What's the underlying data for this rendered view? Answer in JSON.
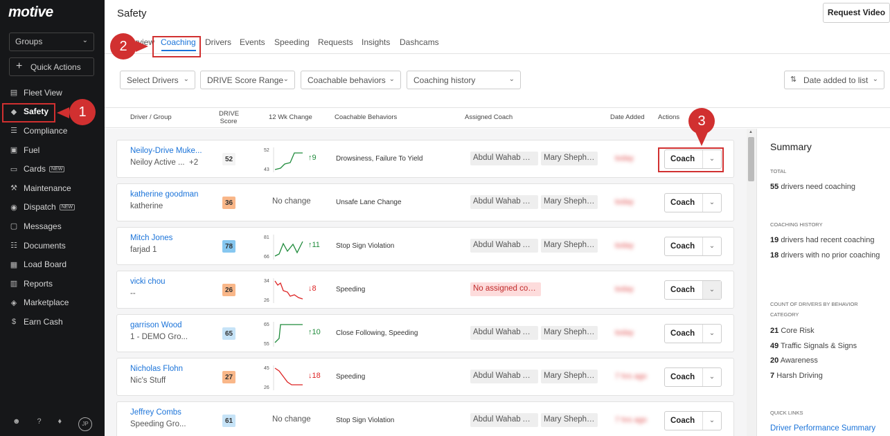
{
  "app": {
    "logo": "motive",
    "page_title": "Safety",
    "request_video": "Request Video"
  },
  "sidebar": {
    "groups_label": "Groups",
    "quick_actions": "Quick Actions",
    "items": [
      {
        "label": "Fleet View",
        "icon": "map-icon"
      },
      {
        "label": "Safety",
        "icon": "shield-icon",
        "active": true
      },
      {
        "label": "Compliance",
        "icon": "document-icon"
      },
      {
        "label": "Fuel",
        "icon": "fuel-icon"
      },
      {
        "label": "Cards",
        "icon": "card-icon",
        "badge": "NEW"
      },
      {
        "label": "Maintenance",
        "icon": "wrench-icon"
      },
      {
        "label": "Dispatch",
        "icon": "location-icon",
        "badge": "NEW"
      },
      {
        "label": "Messages",
        "icon": "messages-icon"
      },
      {
        "label": "Documents",
        "icon": "documents-icon"
      },
      {
        "label": "Load Board",
        "icon": "truck-icon"
      },
      {
        "label": "Reports",
        "icon": "reports-icon"
      },
      {
        "label": "Marketplace",
        "icon": "marketplace-icon"
      },
      {
        "label": "Earn Cash",
        "icon": "dollar-icon"
      }
    ],
    "footer_avatar": "JP"
  },
  "tabs": [
    "Overview",
    "Coaching",
    "Drivers",
    "Events",
    "Speeding",
    "Requests",
    "Insights",
    "Dashcams"
  ],
  "filters": [
    "Select Drivers",
    "DRIVE Score Range",
    "Coachable behaviors",
    "Coaching history"
  ],
  "sort_label": "Date added to list",
  "columns": [
    "Driver / Group",
    "DRIVE Score",
    "12 Wk Change",
    "Coachable Behaviors",
    "Assigned Coach",
    "Date Added",
    "Actions"
  ],
  "rows": [
    {
      "name": "Neiloy-Drive Muke...",
      "group": "Neiloy Active ...",
      "extra": "+2",
      "score": "52",
      "score_color": "#f4f4f4",
      "trend": "up",
      "spark_low": "43",
      "spark_high": "52",
      "change": "9",
      "behaviors": "Drowsiness, Failure To Yield",
      "coach1": "Abdul Wahab An...",
      "coach2": "Mary Shepherd",
      "date": "today",
      "action": "Coach"
    },
    {
      "name": "katherine goodman",
      "group": "katherine",
      "score": "36",
      "score_color": "#f9b789",
      "no_change": "No change",
      "behaviors": "Unsafe Lane Change",
      "coach1": "Abdul Wahab An...",
      "coach2": "Mary Shepherd",
      "date": "today",
      "action": "Coach"
    },
    {
      "name": "Mitch Jones",
      "group": "farjad 1",
      "score": "78",
      "score_color": "#86c7f0",
      "trend": "up",
      "spark_low": "66",
      "spark_high": "81",
      "change": "11",
      "behaviors": "Stop Sign Violation",
      "coach1": "Abdul Wahab An...",
      "coach2": "Mary Shepherd",
      "date": "today",
      "action": "Coach"
    },
    {
      "name": "vicki chou",
      "group": "--",
      "score": "26",
      "score_color": "#f9b789",
      "trend": "down",
      "spark_low": "26",
      "spark_high": "34",
      "change": "8",
      "behaviors": "Speeding",
      "coach1": "No assigned coach",
      "no_coach": true,
      "date": "today",
      "action": "Coach"
    },
    {
      "name": "garrison Wood",
      "group": "1 - DEMO Gro...",
      "score": "65",
      "score_color": "#c6e3f7",
      "trend": "up",
      "spark_low": "55",
      "spark_high": "65",
      "change": "10",
      "behaviors": "Close Following, Speeding",
      "coach1": "Abdul Wahab An...",
      "coach2": "Mary Shepherd",
      "date": "today",
      "action": "Coach"
    },
    {
      "name": "Nicholas Flohn",
      "group": "Nic's Stuff",
      "score": "27",
      "score_color": "#f9b789",
      "trend": "down",
      "spark_low": "26",
      "spark_high": "45",
      "change": "18",
      "behaviors": "Speeding",
      "coach1": "Abdul Wahab An...",
      "coach2": "Mary Shepherd",
      "date": "7 hrs ago",
      "action": "Coach"
    },
    {
      "name": "Jeffrey Combs",
      "group": "Speeding Gro...",
      "score": "61",
      "score_color": "#c6e3f7",
      "no_change": "No change",
      "behaviors": "Stop Sign Violation",
      "coach1": "Abdul Wahab An...",
      "coach2": "Mary Shepherd",
      "date": "7 hrs ago",
      "action": "Coach"
    }
  ],
  "summary": {
    "title": "Summary",
    "total_label": "TOTAL",
    "total_count": "55",
    "total_text": "drivers need coaching",
    "history_label": "COACHING HISTORY",
    "recent_count": "19",
    "recent_text": "drivers had recent coaching",
    "noprior_count": "18",
    "noprior_text": "drivers with no prior coaching",
    "behavior_label": "COUNT OF DRIVERS BY BEHAVIOR CATEGORY",
    "categories": [
      {
        "count": "21",
        "label": "Core Risk"
      },
      {
        "count": "49",
        "label": "Traffic Signals & Signs"
      },
      {
        "count": "20",
        "label": "Awareness"
      },
      {
        "count": "7",
        "label": "Harsh Driving"
      }
    ],
    "quick_links_label": "QUICK LINKS",
    "quick_link": "Driver Performance Summary"
  },
  "callouts": [
    "1",
    "2",
    "3"
  ],
  "colors": {
    "accent": "#1a73d9",
    "callout": "#d13030",
    "sidebar_bg": "#161719",
    "up": "#1e8a3a",
    "down": "#dd2222"
  }
}
